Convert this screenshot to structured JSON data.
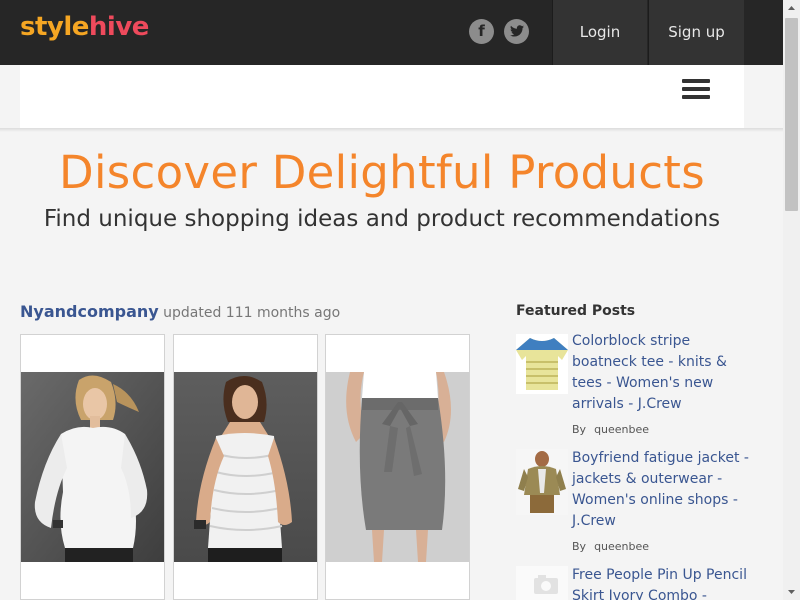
{
  "brand": {
    "part1": "style",
    "part2": "hive",
    "color1": "#f5a623",
    "color2": "#ee4a5c"
  },
  "header": {
    "social": [
      {
        "icon": "facebook-icon",
        "glyph": "f"
      },
      {
        "icon": "twitter-icon"
      }
    ],
    "login_label": "Login",
    "signup_label": "Sign up",
    "menu_icon": "hamburger-menu-icon"
  },
  "hero": {
    "title": "Discover Delightful Products",
    "subtitle": "Find unique shopping ideas and product recommendations",
    "title_color": "#f4852b"
  },
  "post": {
    "author": "Nyandcompany",
    "updated_text": "updated 111 months ago",
    "products": [
      {
        "description": "woman in white blouse"
      },
      {
        "description": "woman in white ruffled top"
      },
      {
        "description": "grey tie-waist skirt"
      }
    ]
  },
  "featured": {
    "title": "Featured Posts",
    "items": [
      {
        "title": "Colorblock stripe boatneck tee - knits & tees - Women's new arrivals - J.Crew",
        "by_label": "By",
        "user": "queenbee"
      },
      {
        "title": "Boyfriend fatigue jacket - jackets & outerwear - Women's online shops - J.Crew",
        "by_label": "By",
        "user": "queenbee"
      },
      {
        "title": "Free People Pin Up Pencil Skirt Ivory Combo -",
        "by_label": "",
        "user": ""
      }
    ]
  },
  "colors": {
    "topbar": "#262626",
    "link": "#3a5691"
  }
}
